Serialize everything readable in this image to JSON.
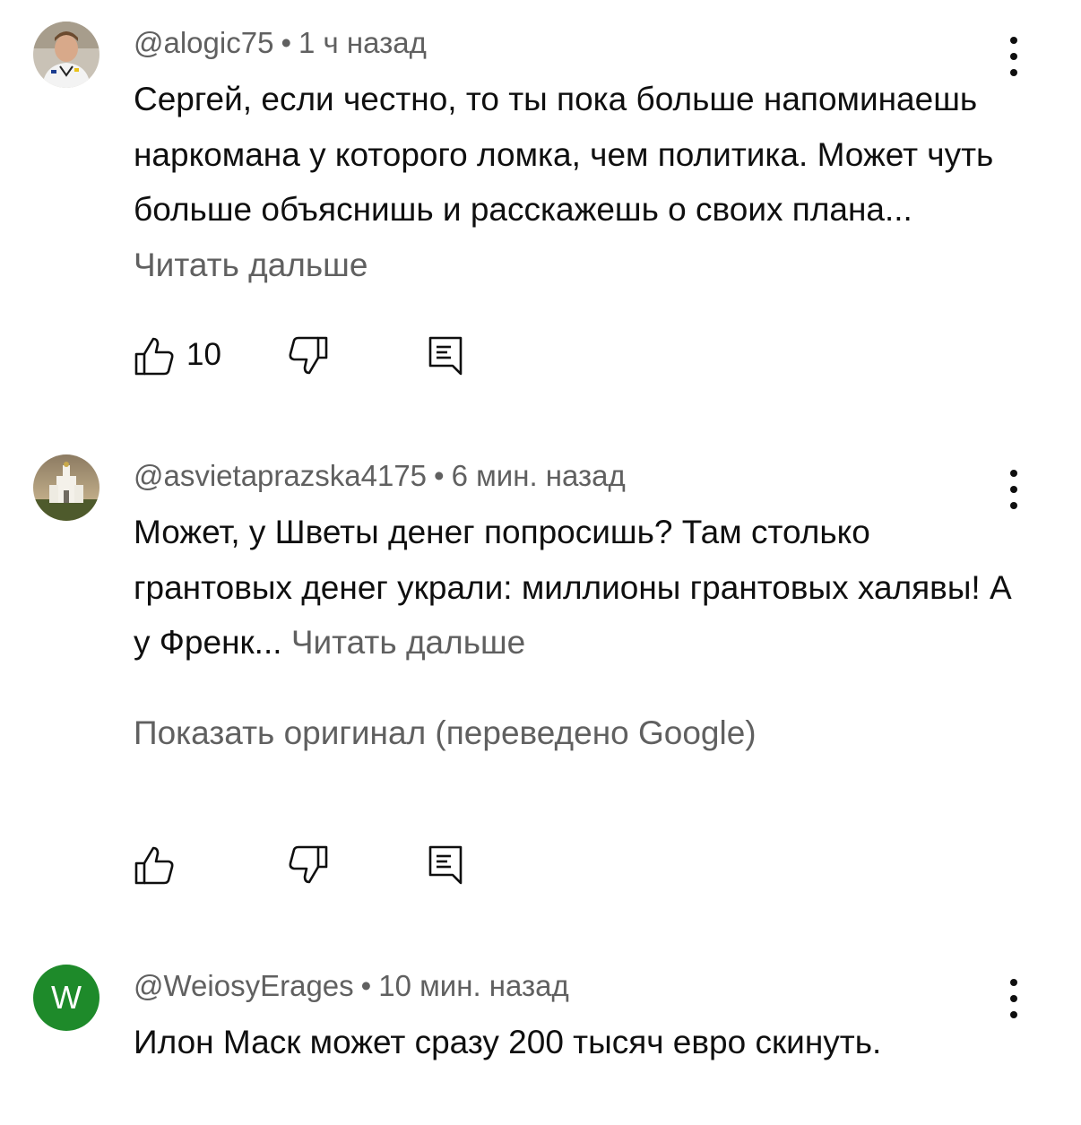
{
  "comments": [
    {
      "author": "@alogic75",
      "time": "1 ч назад",
      "text": "Сергей, если честно, то ты пока больше напоминаешь наркомана у которого ломка, чем политика. Может чуть больше объяснишь и расскажешь о своих плана... ",
      "read_more": "Читать дальше",
      "likes": "10"
    },
    {
      "author": "@asvietaprazska4175",
      "time": "6 мин. назад",
      "text": "Может, у Шветы денег попросишь? Там столько грантовых денег украли: миллионы грантовых халявы! А у Френк... ",
      "read_more": "Читать дальше",
      "show_original": "Показать оригинал (переведено Google)"
    },
    {
      "author": "@WeiosyErages",
      "time": "10 мин. назад",
      "avatar_letter": "W",
      "text": "Илон Маск может сразу 200 тысяч евро скинуть."
    }
  ],
  "separator": "•",
  "icons": {
    "like": "thumbs-up-icon",
    "dislike": "thumbs-down-icon",
    "reply": "reply-icon",
    "menu": "more-vert-icon"
  },
  "colors": {
    "text": "#0f0f0f",
    "secondary": "#606060",
    "avatar_w": "#1e8a2a"
  }
}
